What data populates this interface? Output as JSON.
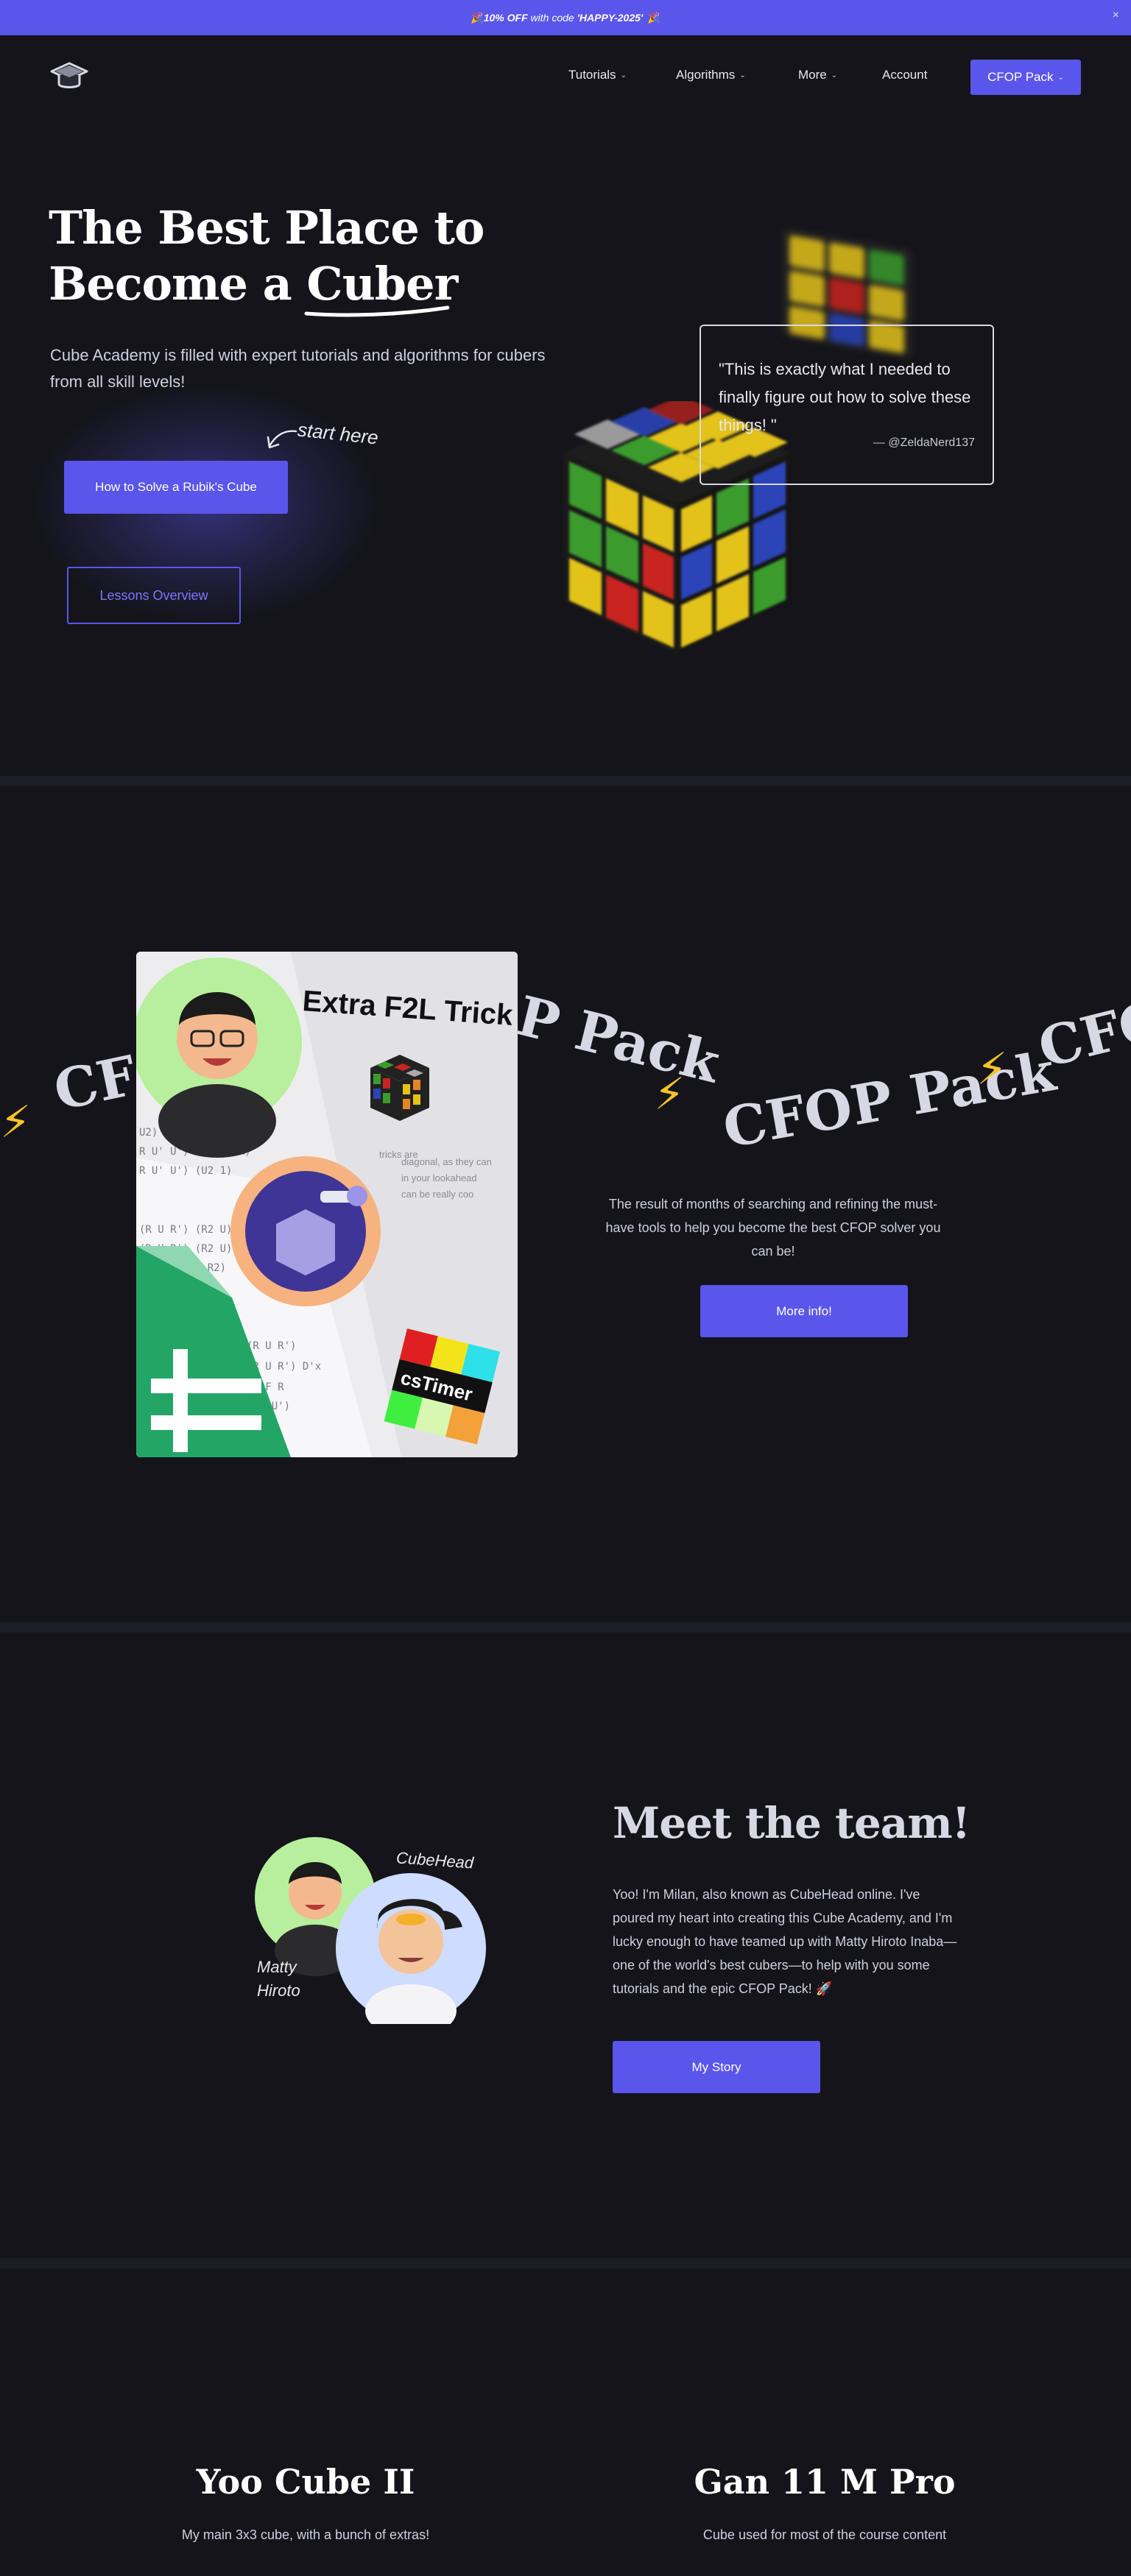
{
  "promo": {
    "emoji_left": "🎉",
    "pct_text": "10% OFF",
    "mid_text": " with code ",
    "code": "'HAPPY-2025'",
    "emoji_right": "🎉",
    "close": "×"
  },
  "nav": {
    "logo_icon": "graduation-cap-icon",
    "items": [
      {
        "label": "Tutorials",
        "has_dropdown": true
      },
      {
        "label": "Algorithms",
        "has_dropdown": true
      },
      {
        "label": "More",
        "has_dropdown": true
      },
      {
        "label": "Account",
        "has_dropdown": false
      }
    ],
    "cta_label": "CFOP Pack",
    "chevron": "⌄"
  },
  "hero": {
    "title_line1": "The Best Place to",
    "title_line2_prefix": "Become a ",
    "title_line2_highlight": "Cuber",
    "subtitle": "Cube Academy is filled with expert tutorials and algorithms for cubers from all skill levels!",
    "annotation": "start here",
    "primary_button": "How to Solve a Rubik's Cube",
    "secondary_button": "Lessons Overview",
    "quote": "\"This is exactly what I needed to finally figure out how to solve these things! \"",
    "quote_author": "— @ZeldaNerd137"
  },
  "cfop": {
    "image_title": "Extra F2L Trick",
    "image_badge": "csTimer",
    "marquee_text": "CFOP Pack",
    "marquee_fragment_left": "CFO",
    "marquee_fragment_mid": "P Pack",
    "marquee_fragment_right": "CFO",
    "description": "The result of months of searching and refining the must-have tools to help you become the best CFOP solver you can be!",
    "button": "More info!"
  },
  "team": {
    "title": "Meet the team!",
    "label_cubehead": "CubeHead",
    "label_matty_1": "Matty",
    "label_matty_2": "Hiroto",
    "text": "Yoo! I'm Milan, also known as CubeHead online. I've poured my heart into creating this Cube Academy, and I'm lucky enough to have teamed up with Matty Hiroto Inaba—one of the world's best cubers—to help with you some tutorials and the epic CFOP Pack! 🚀",
    "button": "My Story"
  },
  "products": [
    {
      "title": "Yoo Cube II",
      "subtitle": "My main 3x3 cube, with a bunch of extras!"
    },
    {
      "title": "Gan 11 M Pro",
      "subtitle": "Cube used for most of the course content"
    }
  ],
  "colors": {
    "accent": "#5a55eb",
    "background": "#14141a",
    "bolt": "#f7c325"
  }
}
